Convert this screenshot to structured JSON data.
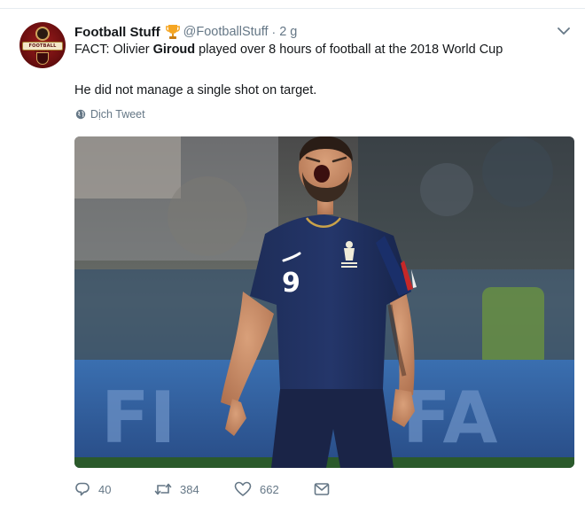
{
  "tweet": {
    "author_name": "Football Stuff",
    "author_handle": "@FootballStuff",
    "separator": "·",
    "time": "2 g",
    "avatar_text": "FOOTBALL STUFF",
    "text_line1_before": "FACT: Olivier ",
    "text_line1_bold": "Giroud",
    "text_line1_after": " played over 8 hours of football at the 2018 World Cup",
    "text_line2": "He did not manage a single shot on target.",
    "translate_label": "Dịch Tweet",
    "jersey_number": "9",
    "actions": {
      "reply_count": "40",
      "retweet_count": "384",
      "like_count": "662"
    }
  },
  "colors": {
    "text": "#14171a",
    "muted": "#657786",
    "trophy": "#f5a623",
    "jersey": "#1b2a55"
  },
  "icons": {
    "trophy": "trophy-icon",
    "caret": "chevron-down-icon",
    "translate": "globe-icon",
    "reply": "reply-icon",
    "retweet": "retweet-icon",
    "like": "heart-icon",
    "message": "envelope-icon"
  }
}
